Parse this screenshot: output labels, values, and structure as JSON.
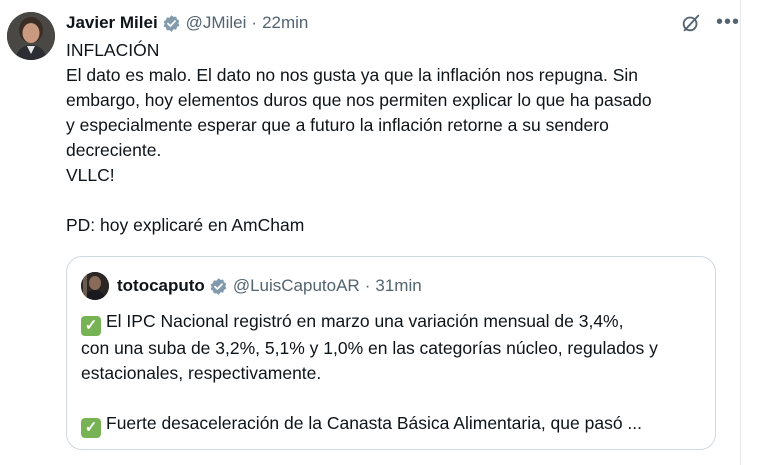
{
  "tweet": {
    "author_name": "Javier Milei",
    "handle": "@JMilei",
    "separator": "·",
    "time": "22min",
    "lines": [
      "INFLACIÓN",
      "El dato es malo. El dato no nos gusta ya que la inflación nos repugna. Sin",
      "embargo, hoy elementos duros que nos permiten explicar lo que ha pasado",
      "y especialmente esperar que a futuro la inflación retorne a su sendero",
      "decreciente.",
      "VLLC!",
      "PD: hoy explicaré en AmCham"
    ]
  },
  "quote": {
    "author_name": "totocaputo",
    "handle": "@LuisCaputoAR",
    "separator": "·",
    "time": "31min",
    "check_glyph": "✓",
    "lines": [
      "El IPC Nacional registró en marzo una variación mensual de 3,4%,",
      "con una suba de 3,2%, 5,1% y 1,0% en las categorías núcleo, regulados y",
      "estacionales, respectivamente.",
      "Fuerte desaceleración de la Canasta Básica Alimentaria, que pasó ..."
    ]
  },
  "icons": {
    "verified": "verified-badge-icon",
    "grok": "grok-icon",
    "more": "more-icon"
  },
  "colors": {
    "verified_badge": "#829aab",
    "check_box": "#77b255",
    "secondary_text": "#536471",
    "border": "#cfd9de"
  }
}
